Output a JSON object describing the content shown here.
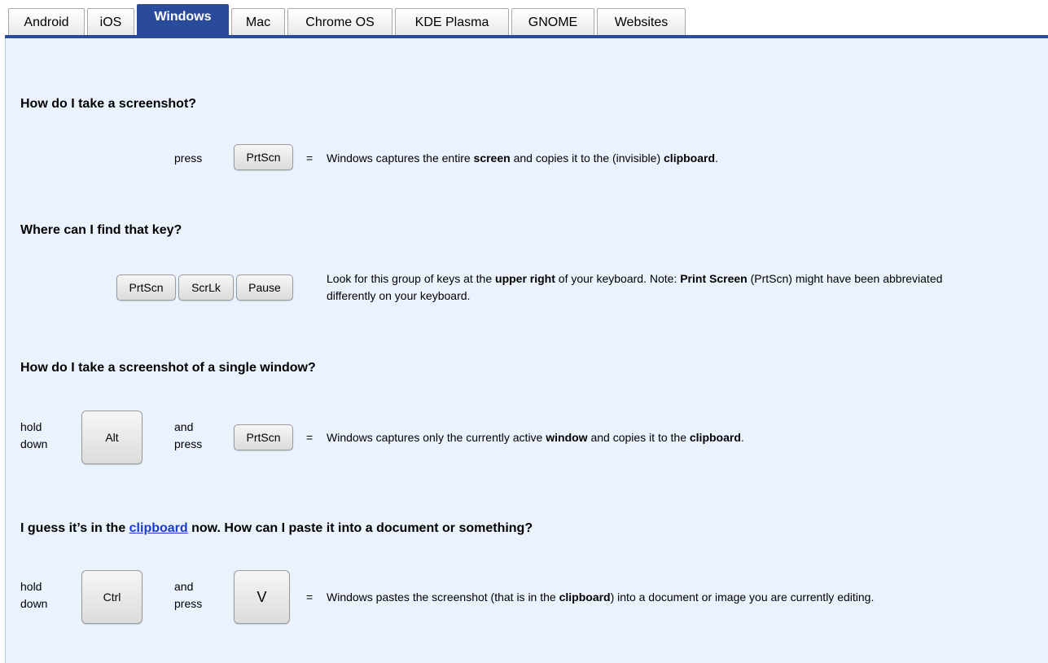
{
  "tabs": [
    {
      "label": "Android"
    },
    {
      "label": "iOS"
    },
    {
      "label": "Windows"
    },
    {
      "label": "Mac"
    },
    {
      "label": "Chrome OS"
    },
    {
      "label": "KDE Plasma"
    },
    {
      "label": "GNOME"
    },
    {
      "label": "Websites"
    }
  ],
  "active_tab": "Windows",
  "colors": {
    "accent": "#2a4b9b",
    "panel": "#eaf3fd",
    "link": "#1a3ccc"
  },
  "sections": {
    "take": {
      "heading": "How do I take a screenshot?",
      "press": "press",
      "key": "PrtScn",
      "equals": "=",
      "desc_a": "Windows captures the entire ",
      "desc_b": "screen",
      "desc_c": " and copies it to the (invisible) ",
      "desc_d": "clipboard",
      "desc_e": "."
    },
    "find": {
      "heading": "Where can I find that key?",
      "keys": [
        "PrtScn",
        "ScrLk",
        "Pause"
      ],
      "desc_a": "Look for this group of keys at the ",
      "desc_b": "upper right",
      "desc_c": " of your keyboard. Note: ",
      "desc_d": "Print Screen",
      "desc_e": " (PrtScn) might have been abbreviated differently on your keyboard."
    },
    "window": {
      "heading": "How do I take a screenshot of a single window?",
      "hold_a": "hold",
      "hold_b": "down",
      "key1": "Alt",
      "and_a": "and",
      "and_b": "press",
      "key2": "PrtScn",
      "equals": "=",
      "desc_a": "Windows captures only the currently active ",
      "desc_b": "window",
      "desc_c": " and copies it to the ",
      "desc_d": "clipboard",
      "desc_e": "."
    },
    "paste": {
      "heading_a": "I guess it’s in the ",
      "heading_link": "clipboard",
      "heading_b": " now. How can I paste it into a document or something?",
      "hold_a": "hold",
      "hold_b": "down",
      "key1": "Ctrl",
      "and_a": "and",
      "and_b": "press",
      "key2": "V",
      "equals": "=",
      "desc_a": "Windows pastes the screenshot (that is in the ",
      "desc_b": "clipboard",
      "desc_c": ") into a document or image you are currently editing."
    }
  }
}
